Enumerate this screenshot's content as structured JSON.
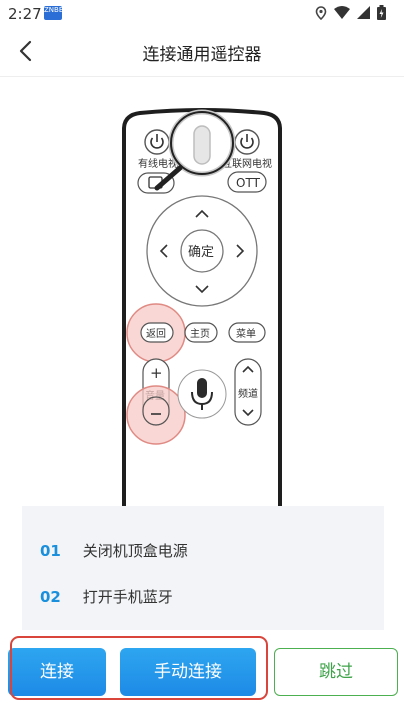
{
  "status_bar": {
    "time": "2:27",
    "notification_label": "ZNBE"
  },
  "header": {
    "title": "连接通用遥控器"
  },
  "remote": {
    "power_left_label": "有线电视",
    "power_right_label": "互联网电视",
    "ott_label": "OTT",
    "ok_label": "确定",
    "back_label": "返回",
    "home_label": "主页",
    "menu_label": "菜单",
    "volume_label": "音量",
    "channel_label": "频道"
  },
  "steps": [
    {
      "number": "01",
      "text": "关闭机顶盒电源"
    },
    {
      "number": "02",
      "text": "打开手机蓝牙"
    }
  ],
  "buttons": {
    "connect": "连接",
    "manual_connect": "手动连接",
    "skip": "跳过"
  },
  "colors": {
    "accent": "#1d8ae6",
    "highlight": "#d9453b",
    "skip_border": "#4caf50"
  }
}
